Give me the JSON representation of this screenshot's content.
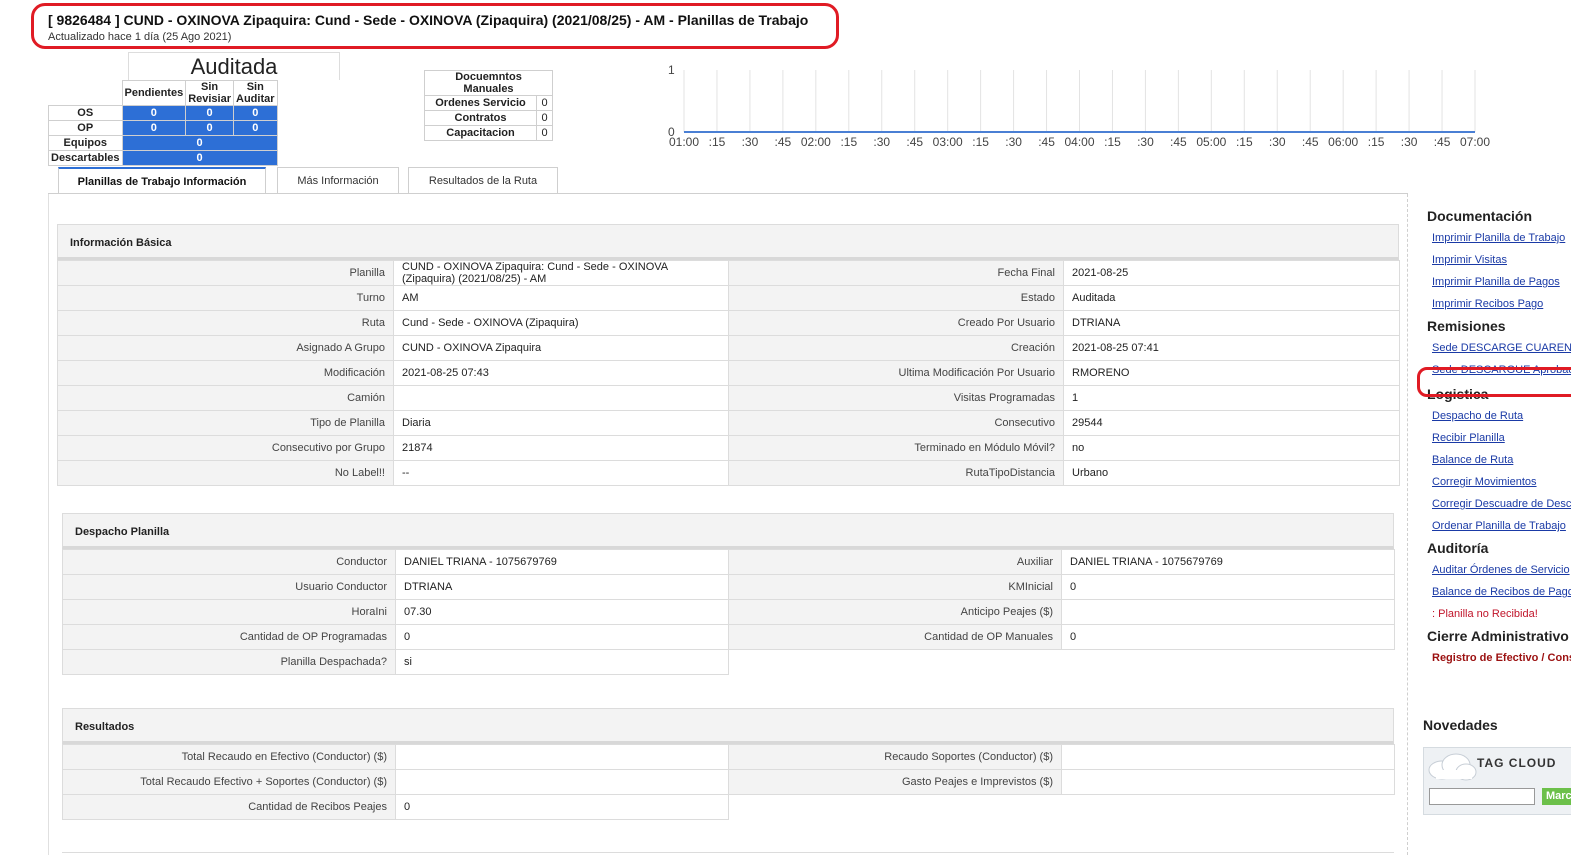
{
  "header": {
    "title": "[ 9826484 ] CUND - OXINOVA Zipaquira: Cund - Sede - OXINOVA (Zipaquira) (2021/08/25) - AM - Planillas de Trabajo",
    "updated": "Actualizado hace 1 día (25 Ago 2021)"
  },
  "status": {
    "title": "Auditada",
    "columns": [
      "Pendientes",
      "Sin Revisiar",
      "Sin Auditar"
    ],
    "rows": [
      {
        "label": "OS",
        "values": [
          "0",
          "0",
          "0"
        ]
      },
      {
        "label": "OP",
        "values": [
          "0",
          "0",
          "0"
        ]
      }
    ],
    "single_rows": [
      {
        "label": "Equipos",
        "value": "0"
      },
      {
        "label": "Descartables",
        "value": "0"
      }
    ]
  },
  "manual_docs": {
    "title": "Docuemntos Manuales",
    "rows": [
      {
        "label": "Ordenes Servicio",
        "value": "0"
      },
      {
        "label": "Contratos",
        "value": "0"
      },
      {
        "label": "Capacitacion",
        "value": "0"
      }
    ]
  },
  "chart_data": {
    "type": "line",
    "x": [
      "01:00",
      ":15",
      ":30",
      ":45",
      "02:00",
      ":15",
      ":30",
      ":45",
      "03:00",
      ":15",
      ":30",
      ":45",
      "04:00",
      ":15",
      ":30",
      ":45",
      "05:00",
      ":15",
      ":30",
      ":45",
      "06:00",
      ":15",
      ":30",
      ":45",
      "07:00"
    ],
    "series": [
      {
        "values": [
          0,
          0,
          0,
          0,
          0,
          0,
          0,
          0,
          0,
          0,
          0,
          0,
          0,
          0,
          0,
          0,
          0,
          0,
          0,
          0,
          0,
          0,
          0,
          0,
          0
        ]
      }
    ],
    "y_ticks": [
      "0",
      "1"
    ],
    "ylim": [
      0,
      1
    ],
    "grid": true,
    "line_color": "#4a7fd4"
  },
  "tabs": [
    {
      "label": "Planillas de Trabajo Información",
      "active": true
    },
    {
      "label": "Más Información",
      "active": false
    },
    {
      "label": "Resultados de la Ruta",
      "active": false
    }
  ],
  "basic_info": {
    "title": "Información Básica",
    "rows": [
      {
        "k1": "Planilla",
        "v1": "CUND - OXINOVA Zipaquira: Cund - Sede - OXINOVA (Zipaquira) (2021/08/25) - AM",
        "k2": "Fecha Final",
        "v2": "2021-08-25"
      },
      {
        "k1": "Turno",
        "v1": "AM",
        "k2": "Estado",
        "v2": "Auditada"
      },
      {
        "k1": "Ruta",
        "v1": "Cund - Sede - OXINOVA (Zipaquira)",
        "k2": "Creado Por Usuario",
        "v2": "DTRIANA"
      },
      {
        "k1": "Asignado A Grupo",
        "v1": "CUND - OXINOVA Zipaquira",
        "k2": "Creación",
        "v2": "2021-08-25 07:41"
      },
      {
        "k1": "Modificación",
        "v1": "2021-08-25 07:43",
        "k2": "Ultima Modificación Por Usuario",
        "v2": "RMORENO"
      },
      {
        "k1": "Camión",
        "v1": "",
        "k2": "Visitas Programadas",
        "v2": "1"
      },
      {
        "k1": "Tipo de Planilla",
        "v1": "Diaria",
        "k2": "Consecutivo",
        "v2": "29544"
      },
      {
        "k1": "Consecutivo por Grupo",
        "v1": "21874",
        "k2": "Terminado en Módulo Móvil?",
        "v2": "no"
      },
      {
        "k1": "No Label!!",
        "v1": "--",
        "k2": "RutaTipoDistancia",
        "v2": "Urbano"
      }
    ]
  },
  "dispatch": {
    "title": "Despacho Planilla",
    "rows": [
      {
        "k1": "Conductor",
        "v1": "DANIEL TRIANA - 1075679769",
        "k2": "Auxiliar",
        "v2": "DANIEL TRIANA - 1075679769"
      },
      {
        "k1": "Usuario Conductor",
        "v1": "DTRIANA",
        "k2": "KMInicial",
        "v2": "0"
      },
      {
        "k1": "HoraIni",
        "v1": "07.30",
        "k2": "Anticipo Peajes ($)",
        "v2": ""
      },
      {
        "k1": "Cantidad de OP Programadas",
        "v1": "0",
        "k2": "Cantidad de OP Manuales",
        "v2": "0"
      },
      {
        "k1": "Planilla Despachada?",
        "v1": "si"
      }
    ]
  },
  "results": {
    "title": "Resultados",
    "rows": [
      {
        "k1": "Total Recaudo en Efectivo (Conductor) ($)",
        "v1": "",
        "k2": "Recaudo Soportes (Conductor) ($)",
        "v2": ""
      },
      {
        "k1": "Total Recaudo Efectivo + Soportes (Conductor) ($)",
        "v1": "",
        "k2": "Gasto Peajes e Imprevistos ($)",
        "v2": ""
      },
      {
        "k1": "Cantidad de Recibos Peajes",
        "v1": "0"
      }
    ]
  },
  "sidebar": {
    "documentacion": {
      "title": "Documentación",
      "links": [
        "Imprimir Planilla de Trabajo",
        "Imprimir Visitas",
        "Imprimir Planilla de Pagos",
        "Imprimir Recibos Pago"
      ]
    },
    "remisiones": {
      "title": "Remisiones",
      "links": [
        "Sede DESCARGE CUARENTENA",
        "Sede DESCARGUE Aprobado"
      ]
    },
    "logistica": {
      "title": "Logistica",
      "links": [
        "Despacho de Ruta",
        "Recibir Planilla",
        "Balance de Ruta",
        "Corregir Movimientos",
        "Corregir Descuadre de Descartables",
        "Ordenar Planilla de Trabajo"
      ]
    },
    "auditoria": {
      "title": "Auditoría",
      "links": [
        "Auditar Órdenes de Servicio",
        "Balance de Recibos de Pago"
      ],
      "warning": ": Planilla no Recibida!"
    },
    "cierre": {
      "title": "Cierre Administrativo",
      "link": "Registro de Efectivo / Consignaciones"
    },
    "novedades": {
      "title": "Novedades",
      "tag_cloud": "TAG CLOUD",
      "button": "Marcar"
    }
  },
  "colors": {
    "status_fill": "#2d6fd6",
    "highlight_ring": "#e01b24",
    "link": "#1a3aa6"
  }
}
